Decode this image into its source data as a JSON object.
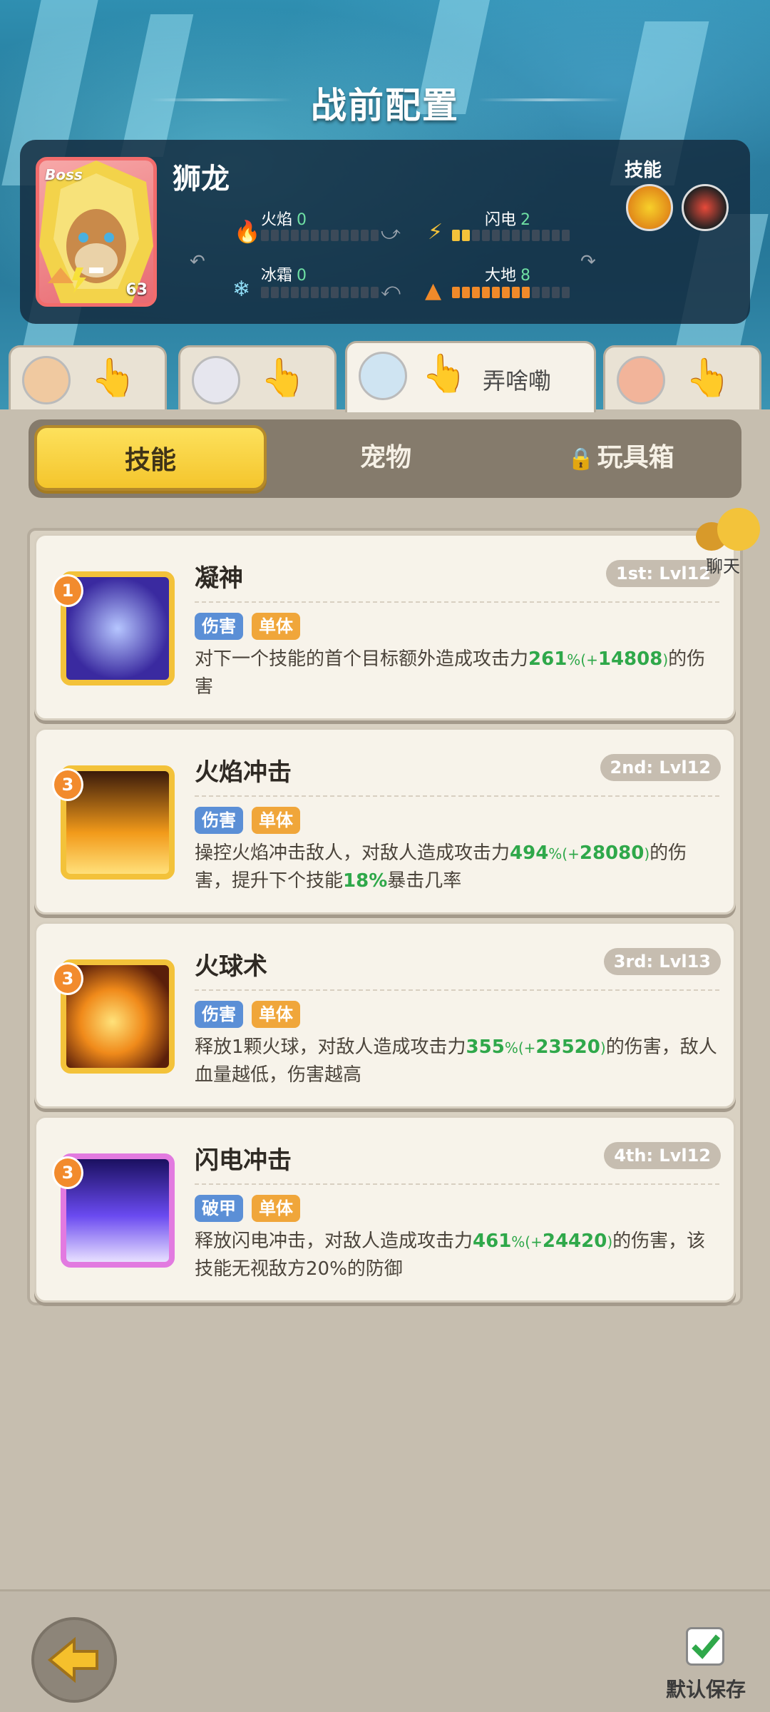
{
  "header": {
    "title": "战前配置"
  },
  "boss": {
    "badge": "Boss",
    "name": "狮龙",
    "level": "63",
    "skills_label": "技能",
    "elements": {
      "fire": {
        "label": "火焰",
        "value": "0",
        "level": 0
      },
      "lightning": {
        "label": "闪电",
        "value": "2",
        "level": 2
      },
      "frost": {
        "label": "冰霜",
        "value": "0",
        "level": 0
      },
      "earth": {
        "label": "大地",
        "value": "8",
        "level": 8
      }
    }
  },
  "characters": [
    {
      "name": "",
      "active": false
    },
    {
      "name": "",
      "active": false
    },
    {
      "name": "弄啥嘞",
      "active": true
    },
    {
      "name": "",
      "active": false
    }
  ],
  "tabs": {
    "skills": "技能",
    "pets": "宠物",
    "toybox": "玩具箱",
    "active": "技能"
  },
  "chat": {
    "label": "聊天"
  },
  "skills": [
    {
      "rank": "1",
      "name": "凝神",
      "level": "1st: Lvl12",
      "tag1": "伤害",
      "tag2": "单体",
      "desc_a": "对下一个技能的首个目标额外造成攻击力",
      "pct": "261",
      "bonus": "14808",
      "desc_b": "的伤害",
      "desc_c": "",
      "pct2": "",
      "desc_d": ""
    },
    {
      "rank": "3",
      "name": "火焰冲击",
      "level": "2nd: Lvl12",
      "tag1": "伤害",
      "tag2": "单体",
      "desc_a": "操控火焰冲击敌人，对敌人造成攻击力",
      "pct": "494",
      "bonus": "28080",
      "desc_b": "的伤害，提升下个技能",
      "desc_c": "",
      "pct2": "18",
      "desc_d": "暴击几率"
    },
    {
      "rank": "3",
      "name": "火球术",
      "level": "3rd: Lvl13",
      "tag1": "伤害",
      "tag2": "单体",
      "desc_a": "释放1颗火球，对敌人造成攻击力",
      "pct": "355",
      "bonus": "23520",
      "desc_b": "的伤害，敌人血量越低，伤害越高",
      "desc_c": "",
      "pct2": "",
      "desc_d": ""
    },
    {
      "rank": "3",
      "name": "闪电冲击",
      "level": "4th: Lvl12",
      "tag1": "破甲",
      "tag2": "单体",
      "desc_a": "释放闪电冲击，对敌人造成攻击力",
      "pct": "461",
      "bonus": "24420",
      "desc_b": "的伤害，该技能无视敌方20%的防御",
      "desc_c": "",
      "pct2": "",
      "desc_d": ""
    }
  ],
  "footer": {
    "save_label": "默认保存"
  },
  "colors": {
    "accent_yellow": "#f4c52c",
    "green_value": "#2fa84a",
    "tag_blue": "#5b8fd6",
    "tag_orange": "#f0a63a"
  }
}
